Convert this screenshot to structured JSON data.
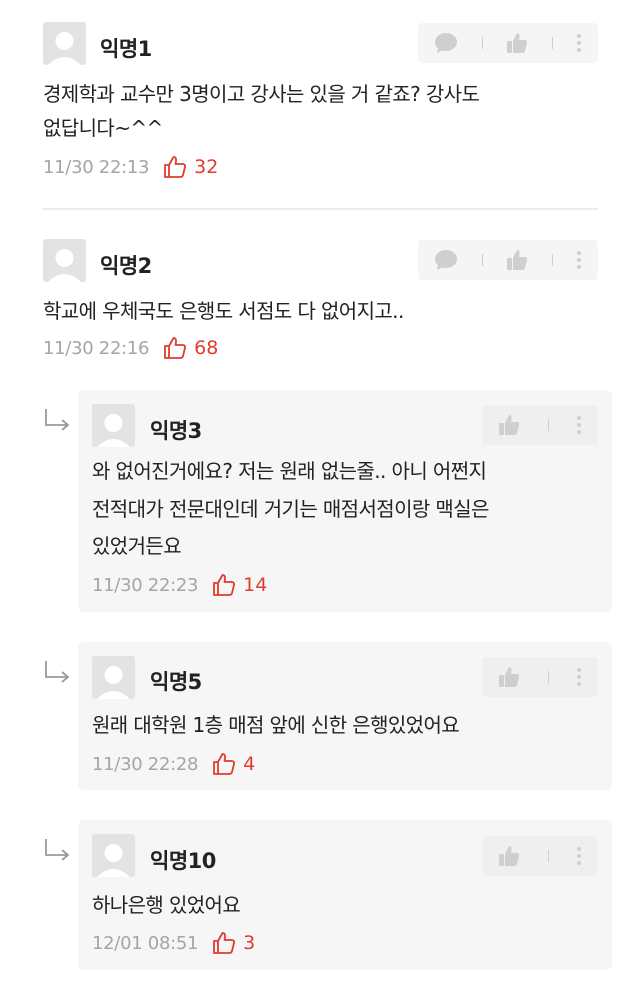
{
  "comments": [
    {
      "author": "익명1",
      "lines": [
        "경제학과 교수만 3명이고 강사는 있을 거 같죠? 강사도",
        "없답니다~^^"
      ],
      "time": "11/30 22:13",
      "likes": "32"
    },
    {
      "author": "익명2",
      "lines": [
        "학교에 우체국도 은행도 서점도 다 없어지고.."
      ],
      "time": "11/30 22:16",
      "likes": "68"
    }
  ],
  "replies": [
    {
      "author": "익명3",
      "lines": [
        "와 없어진거에요? 저는 원래 없는줄.. 아니 어쩐지",
        "전적대가 전문대인데 거기는  매점서점이랑 맥실은",
        "있었거든요"
      ],
      "time": "11/30 22:23",
      "likes": "14"
    },
    {
      "author": "익명5",
      "lines": [
        "원래 대학원 1층 매점 앞에 신한 은행있었어요"
      ],
      "time": "11/30 22:28",
      "likes": "4"
    },
    {
      "author": "익명10",
      "lines": [
        "하나은행 있었어요"
      ],
      "time": "12/01 08:51",
      "likes": "3"
    }
  ],
  "icons": {
    "comment": "speech-bubble-icon",
    "like": "thumbs-up-icon",
    "more": "vertical-dots-icon",
    "reply": "reply-arrow-icon",
    "avatar": "anonymous-avatar-icon",
    "heart_like": "thumbs-up-outline-icon"
  },
  "colors": {
    "like_red": "#e03c2e",
    "time_gray": "#a5a5a5",
    "reply_bg": "#f6f6f6",
    "action_bg": "#f5f5f5"
  }
}
